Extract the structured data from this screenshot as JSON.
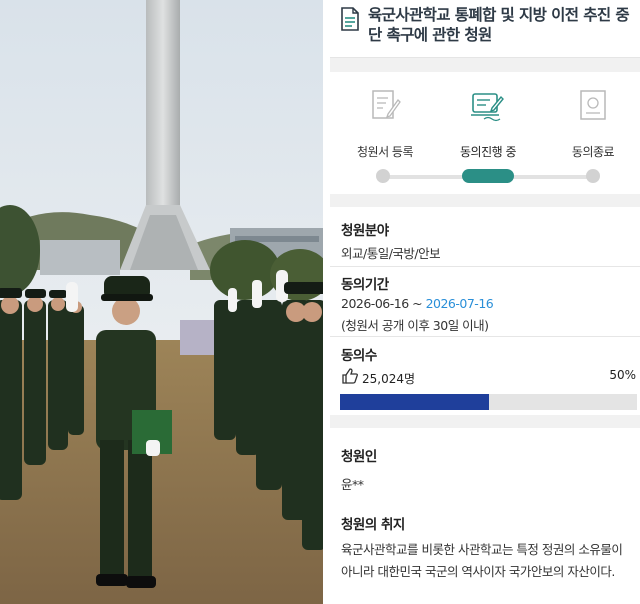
{
  "petition": {
    "title": "육군사관학교 통폐합 및 지방 이전 추진 중단 촉구에 관한 청원",
    "steps": [
      {
        "label": "청원서 등록",
        "icon": "pencil-document-icon",
        "state": "done"
      },
      {
        "label": "동의진행 중",
        "icon": "signing-tablet-icon",
        "state": "active"
      },
      {
        "label": "동의종료",
        "icon": "certificate-icon",
        "state": "pending"
      }
    ],
    "field_label": "청원분야",
    "field_value": "외교/통일/국방/안보",
    "period_label": "동의기간",
    "period_start": "2026-06-16",
    "period_sep": " ~ ",
    "period_end": "2026-07-16",
    "period_note": "(청원서 공개 이후 30일 이내)",
    "agree_label": "동의수",
    "agree_count": "25,024명",
    "agree_percent_text": "50%",
    "agree_fraction": 0.5,
    "petitioner_label": "청원인",
    "petitioner_name": "윤**",
    "purpose_label": "청원의 취지",
    "purpose_text": "육군사관학교를 비롯한 사관학교는 특정 정권의 소유물이 아니라 대한민국 국군의 역사이자 국가안보의 자산이다."
  },
  "colors": {
    "active_step": "#2b8f86",
    "progress_fill": "#1f3f9b",
    "date_end": "#2a8fd8",
    "title_text": "#2e3a46"
  }
}
